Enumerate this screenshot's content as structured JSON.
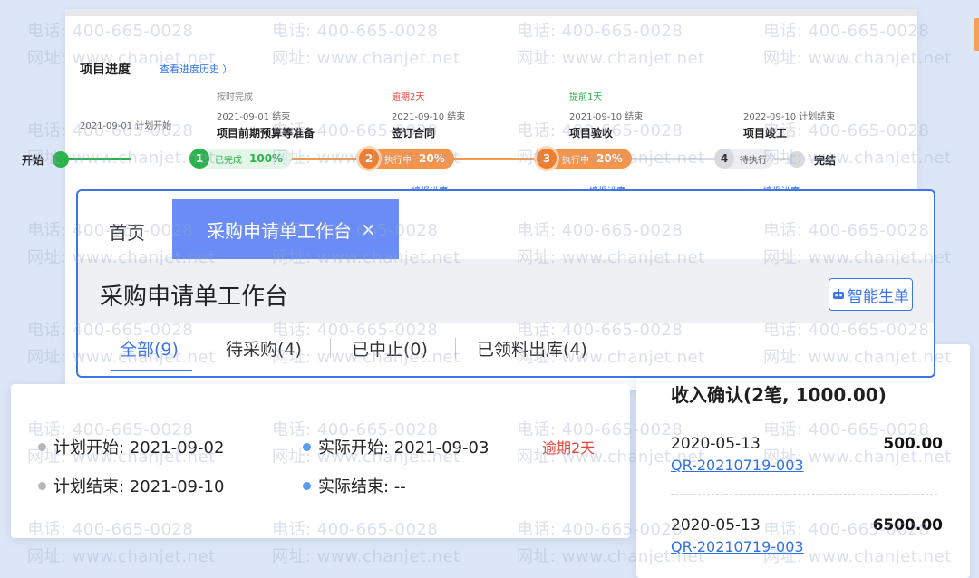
{
  "progress": {
    "title": "项目进度",
    "history_link": "查看进度历史 ）",
    "start_label": "开始",
    "end_label": "完结",
    "milestones": [
      {
        "num": "1",
        "status": "按时完成",
        "date": "2021-09-01 结束",
        "name": "项目前期预算等准备",
        "pill_label": "已完成",
        "percent": "100%",
        "sub": "",
        "status_color": "#888888"
      },
      {
        "num": "2",
        "status": "逾期2天",
        "date": "2021-09-10 结束",
        "name": "签订合同",
        "pill_label": "执行中",
        "percent": "20%",
        "sub": "填报进度",
        "status_color": "#e8443a"
      },
      {
        "num": "3",
        "status": "提前1天",
        "date": "2021-09-10 结束",
        "name": "项目验收",
        "pill_label": "执行中",
        "percent": "20%",
        "sub": "填报进度",
        "status_color": "#2bb24c"
      },
      {
        "num": "4",
        "status": "",
        "date": "2022-09-10 计划结束",
        "name": "项目竣工",
        "pill_label": "待执行",
        "percent": "",
        "sub": "填报进度",
        "status_color": "#888888"
      }
    ],
    "start_plan": "2021-09-01 计划开始"
  },
  "dialog": {
    "tab_home": "首页",
    "tab_active": "采购申请单工作台",
    "tab_close": "×",
    "page_title": "采购申请单工作台",
    "smart_button": "智能生单",
    "filters": [
      {
        "label": "全部(9)"
      },
      {
        "label": "待采购(4)"
      },
      {
        "label": "已中止(0)"
      },
      {
        "label": "已领料出库(4)"
      }
    ]
  },
  "schedule": {
    "plan_start": "计划开始: 2021-09-02",
    "plan_end": "计划结束: 2021-09-10",
    "actual_start": "实际开始: 2021-09-03",
    "actual_end": "实际结束: --",
    "overdue": "逾期2天"
  },
  "income": {
    "title": "收入确认(2笔, 1000.00)",
    "items": [
      {
        "date": "2020-05-13",
        "amount": "500.00",
        "code": "QR-20210719-003"
      },
      {
        "date": "2020-05-13",
        "amount": "6500.00",
        "code": "QR-20210719-003"
      }
    ]
  },
  "watermark": {
    "phone": "电话: 400-665-0028",
    "site": "网址: www.chanjet.net"
  },
  "colors": {
    "accent": "#3d74ea",
    "tab_active_bg": "#6a8cf7",
    "success": "#2bb24c",
    "warning": "#f5944a",
    "danger": "#e8443a"
  }
}
